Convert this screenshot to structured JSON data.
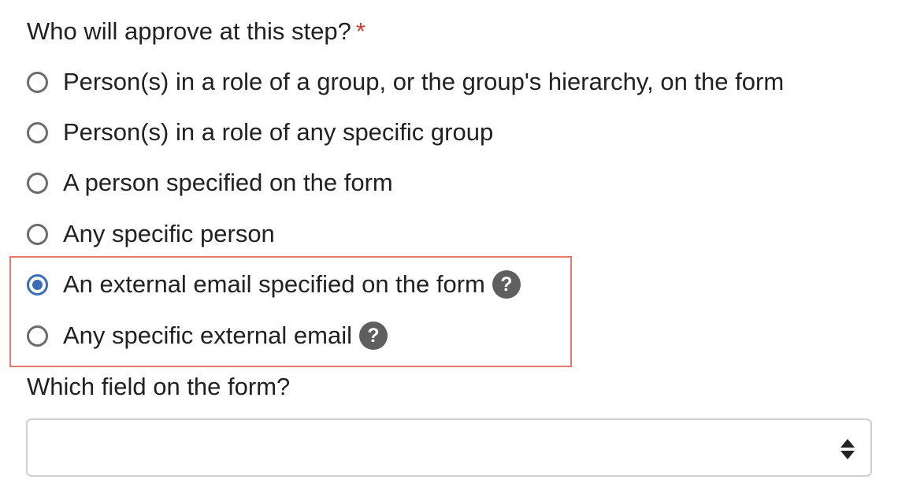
{
  "question": {
    "text": "Who will approve at this step?",
    "required_mark": "*"
  },
  "options": [
    {
      "label": "Person(s) in a role of a group, or the group's hierarchy, on the form",
      "selected": false,
      "help_icon": ""
    },
    {
      "label": "Person(s) in a role of any specific group",
      "selected": false,
      "help_icon": ""
    },
    {
      "label": "A person specified on the form",
      "selected": false,
      "help_icon": ""
    },
    {
      "label": "Any specific person",
      "selected": false,
      "help_icon": ""
    },
    {
      "label": "An external email specified on the form",
      "selected": true,
      "help_icon": "question-icon",
      "help_text": "?"
    },
    {
      "label": "Any specific external email",
      "selected": false,
      "help_icon": "question-icon",
      "help_text": "?"
    }
  ],
  "field_question": {
    "text": "Which field on the form?"
  },
  "field_select": {
    "value": "",
    "icon": "up-down-arrows-icon"
  },
  "colors": {
    "accent": "#3a6db5",
    "required": "#d33a2c",
    "highlight_border": "#e57b6e",
    "help_icon_bg": "#5f5f5f"
  }
}
